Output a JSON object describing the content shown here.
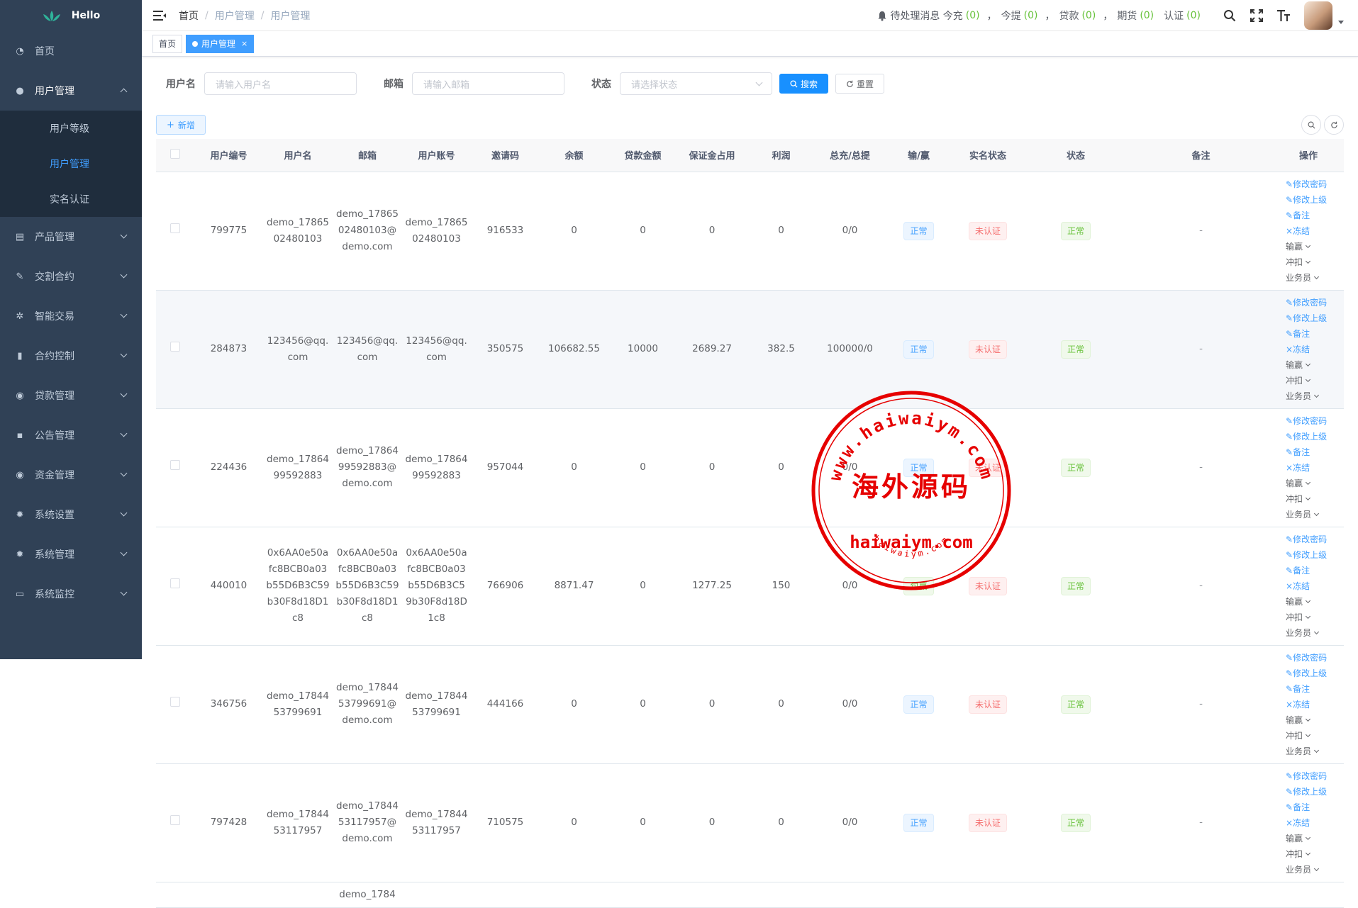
{
  "sidebar": {
    "logo_text": "Hello",
    "items": [
      {
        "label": "首页",
        "icon": "dashboard-icon"
      },
      {
        "label": "用户管理",
        "icon": "user-icon"
      },
      {
        "label": "产品管理",
        "icon": "document-icon"
      },
      {
        "label": "交割合约",
        "icon": "edit-icon"
      },
      {
        "label": "智能交易",
        "icon": "gear-icon"
      },
      {
        "label": "合约控制",
        "icon": "chart-icon"
      },
      {
        "label": "贷款管理",
        "icon": "money-icon"
      },
      {
        "label": "公告管理",
        "icon": "message-icon"
      },
      {
        "label": "资金管理",
        "icon": "money-icon"
      },
      {
        "label": "系统设置",
        "icon": "setting-icon"
      },
      {
        "label": "系统管理",
        "icon": "setting-icon"
      },
      {
        "label": "系统监控",
        "icon": "monitor-icon"
      }
    ],
    "submenu": [
      "用户等级",
      "用户管理",
      "实名认证"
    ]
  },
  "header": {
    "breadcrumb": [
      "首页",
      "用户管理",
      "用户管理"
    ],
    "notice_label": "待处理消息 今充",
    "notice": [
      {
        "label": "今充",
        "count": "(0)"
      },
      {
        "label": "今提",
        "count": "(0)"
      },
      {
        "label": "贷款",
        "count": "(0)"
      },
      {
        "label": "期货",
        "count": "(0)"
      },
      {
        "label": "认证",
        "count": "(0)"
      }
    ],
    "separator": "，"
  },
  "tags": {
    "home": "首页",
    "active": "用户管理",
    "close": "×"
  },
  "search": {
    "username_label": "用户名",
    "username_placeholder": "请输入用户名",
    "email_label": "邮箱",
    "email_placeholder": "请输入邮箱",
    "status_label": "状态",
    "status_placeholder": "请选择状态",
    "search_btn": "搜索",
    "reset_btn": "重置"
  },
  "toolbar": {
    "add_btn": "新增"
  },
  "table": {
    "columns": [
      "用户编号",
      "用户名",
      "邮箱",
      "用户账号",
      "邀请码",
      "余额",
      "贷款金额",
      "保证金占用",
      "利润",
      "总充/总提",
      "输/赢",
      "实名状态",
      "状态",
      "备注",
      "操作"
    ],
    "ops": {
      "change_pwd": "修改密码",
      "change_parent": "修改上级",
      "remark": "备注",
      "freeze": "冻结",
      "winlose": "输赢",
      "offset": "冲扣",
      "salesman": "业务员"
    },
    "rows": [
      {
        "id": "799775",
        "username": "demo_1786502480103",
        "email": "demo_1786502480103@demo.com",
        "account": "demo_1786502480103",
        "invite": "916533",
        "balance": "0",
        "loan": "0",
        "margin": "0",
        "profit": "0",
        "total": "0/0",
        "winlose": "正常",
        "winlose_color": "blue",
        "realname": "未认证",
        "status": "正常",
        "remark": "-"
      },
      {
        "id": "284873",
        "username": "123456@qq.com",
        "email": "123456@qq.com",
        "account": "123456@qq.com",
        "invite": "350575",
        "balance": "106682.55",
        "loan": "10000",
        "margin": "2689.27",
        "profit": "382.5",
        "total": "100000/0",
        "winlose": "正常",
        "winlose_color": "blue",
        "realname": "未认证",
        "status": "正常",
        "remark": "-"
      },
      {
        "id": "224436",
        "username": "demo_1786499592883",
        "email": "demo_1786499592883@demo.com",
        "account": "demo_1786499592883",
        "invite": "957044",
        "balance": "0",
        "loan": "0",
        "margin": "0",
        "profit": "0",
        "total": "0/0",
        "winlose": "正常",
        "winlose_color": "blue",
        "realname": "未认证",
        "status": "正常",
        "remark": "-"
      },
      {
        "id": "440010",
        "username": "0x6AA0e50afc8BCB0a03b55D6B3C59b30F8d18D1c8",
        "email": "0x6AA0e50afc8BCB0a03b55D6B3C59b30F8d18D1c8",
        "account": "0x6AA0e50afc8BCB0a03b55D6B3C59b30F8d18D1c8",
        "invite": "766906",
        "balance": "8871.47",
        "loan": "0",
        "margin": "1277.25",
        "profit": "150",
        "total": "0/0",
        "winlose": "包赢",
        "winlose_color": "green",
        "realname": "未认证",
        "status": "正常",
        "remark": "-"
      },
      {
        "id": "346756",
        "username": "demo_1784453799691",
        "email": "demo_1784453799691@demo.com",
        "account": "demo_1784453799691",
        "invite": "444166",
        "balance": "0",
        "loan": "0",
        "margin": "0",
        "profit": "0",
        "total": "0/0",
        "winlose": "正常",
        "winlose_color": "blue",
        "realname": "未认证",
        "status": "正常",
        "remark": "-"
      },
      {
        "id": "797428",
        "username": "demo_1784453117957",
        "email": "demo_1784453117957@demo.com",
        "account": "demo_1784453117957",
        "invite": "710575",
        "balance": "0",
        "loan": "0",
        "margin": "0",
        "profit": "0",
        "total": "0/0",
        "winlose": "正常",
        "winlose_color": "blue",
        "realname": "未认证",
        "status": "正常",
        "remark": "-"
      },
      {
        "id": "",
        "username": "",
        "email": "demo_1784",
        "account": "",
        "invite": "",
        "balance": "",
        "loan": "",
        "margin": "",
        "profit": "",
        "total": "",
        "winlose": "",
        "winlose_color": "",
        "realname": "",
        "status": "",
        "remark": ""
      }
    ]
  },
  "watermark": {
    "line1": "www.haiwaiym.com",
    "cn": "海外源码",
    "domain": "haiwaiym.com",
    "small": "haiwaiym.com"
  },
  "colors": {
    "sidebar_bg": "#304156",
    "submenu_bg": "#1f2d3d",
    "primary": "#409eff",
    "stamp_red": "#e60000"
  }
}
